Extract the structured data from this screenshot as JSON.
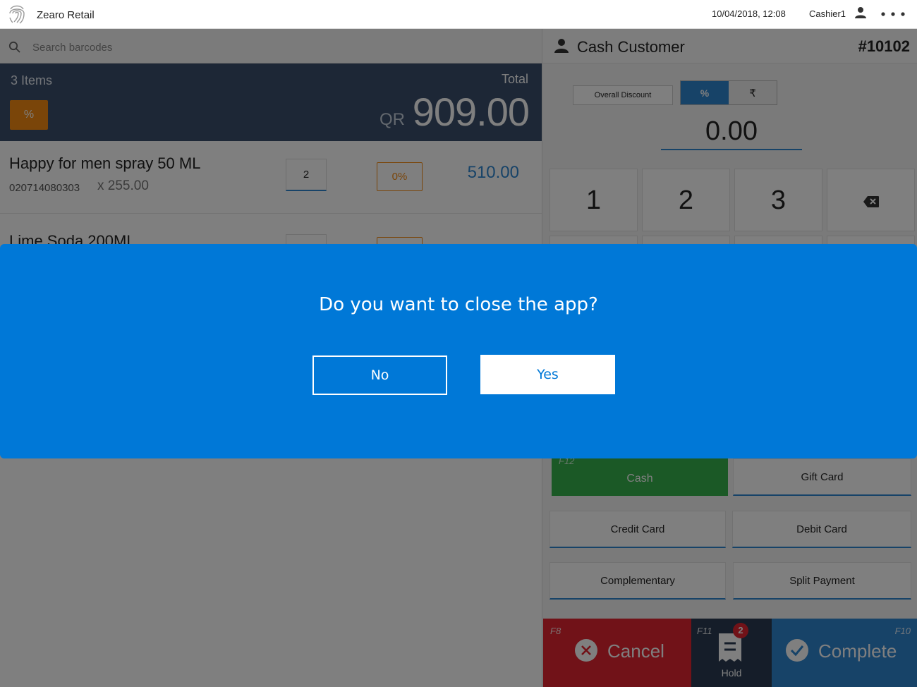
{
  "topbar": {
    "app_title": "Zearo Retail",
    "datetime": "10/04/2018, 12:08",
    "cashier": "Cashier1",
    "logo_icon": "fingerprint-icon",
    "user_icon": "user-icon",
    "more_icon": "more-dots-icon"
  },
  "search": {
    "placeholder": "Search barcodes",
    "icon": "search-icon"
  },
  "summary": {
    "items_count": "3 Items",
    "discount_button": "%",
    "total_label": "Total",
    "currency": "QR",
    "total": "909.00"
  },
  "cart": [
    {
      "name": "Happy for men spray 50 ML",
      "barcode": "020714080303",
      "unit_price": "x 255.00",
      "qty": "2",
      "discount": "0%",
      "line_total": "510.00"
    },
    {
      "name": "Lime Soda 200ML"
    }
  ],
  "customer": {
    "name": "Cash Customer",
    "order_number": "#10102",
    "icon": "person-icon"
  },
  "discount_panel": {
    "label": "Overall Discount",
    "percent_option": "%",
    "currency_option": "₹",
    "value": "0.00"
  },
  "numpad": {
    "keys": [
      "1",
      "2",
      "3"
    ],
    "backspace_icon": "backspace-icon"
  },
  "payment": {
    "cash": {
      "label": "Cash",
      "key": "F12"
    },
    "gift_card": "Gift Card",
    "credit_card": "Credit Card",
    "debit_card": "Debit Card",
    "complementary": "Complementary",
    "split_payment": "Split Payment"
  },
  "actions": {
    "cancel": {
      "label": "Cancel",
      "key": "F8"
    },
    "hold": {
      "label": "Hold",
      "key": "F11",
      "badge": "2"
    },
    "complete": {
      "label": "Complete",
      "key": "F10"
    }
  },
  "dialog": {
    "message": "Do you want to close the app?",
    "no": "No",
    "yes": "Yes"
  },
  "colors": {
    "dialog_bg": "#0078d7",
    "accent_blue": "#2f86d1",
    "orange": "#f48a12",
    "cancel_red": "#e32530",
    "cash_green": "#37b24d",
    "summary_bg": "#3a4f6c"
  }
}
